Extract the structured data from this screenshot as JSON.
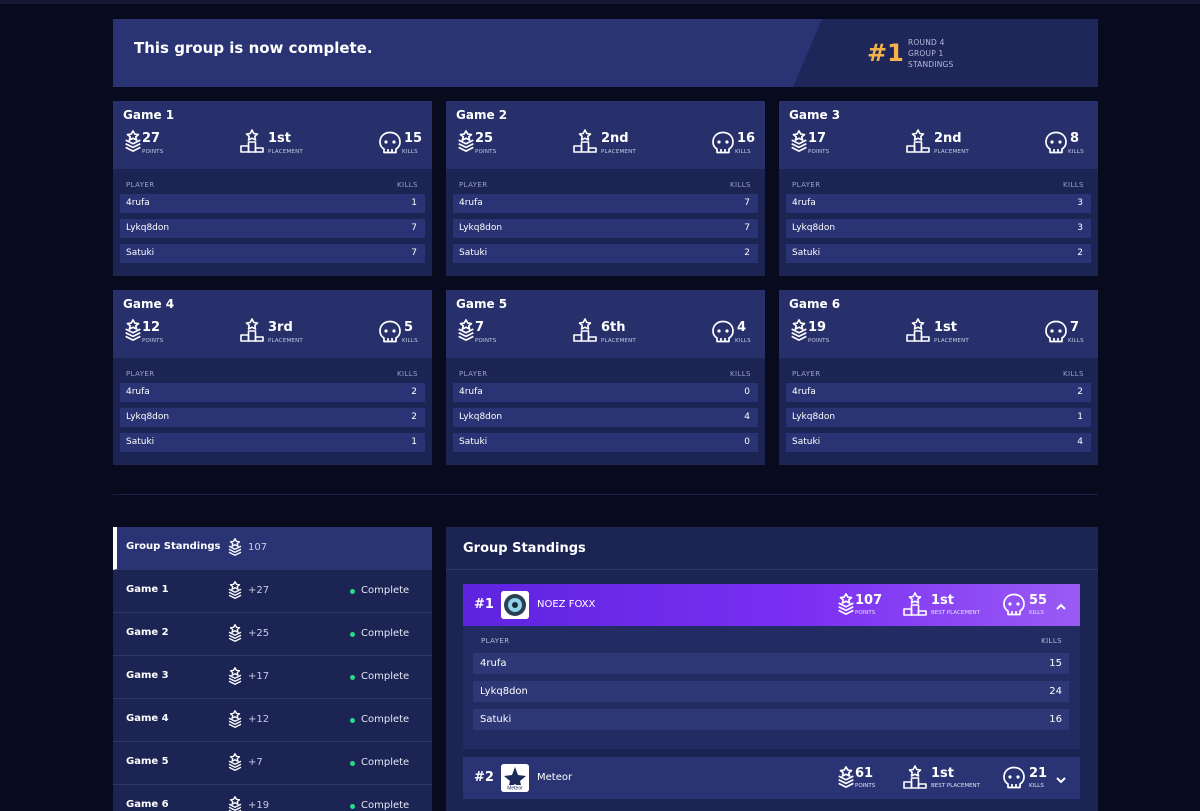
{
  "banner": {
    "message": "This group is now complete.",
    "rank": "#1",
    "meta": [
      "ROUND 4",
      "GROUP 1",
      "STANDINGS"
    ]
  },
  "labels": {
    "points": "POINTS",
    "placement": "PLACEMENT",
    "kills": "KILLS",
    "player": "PLAYER",
    "best_placement": "BEST PLACEMENT",
    "complete": "Complete"
  },
  "games": [
    {
      "title": "Game 1",
      "points": "27",
      "placement": "1st",
      "kills": "15",
      "players": [
        {
          "name": "4rufa",
          "kills": "1"
        },
        {
          "name": "Lykq8don",
          "kills": "7"
        },
        {
          "name": "Satuki",
          "kills": "7"
        }
      ]
    },
    {
      "title": "Game 2",
      "points": "25",
      "placement": "2nd",
      "kills": "16",
      "players": [
        {
          "name": "4rufa",
          "kills": "7"
        },
        {
          "name": "Lykq8don",
          "kills": "7"
        },
        {
          "name": "Satuki",
          "kills": "2"
        }
      ]
    },
    {
      "title": "Game 3",
      "points": "17",
      "placement": "2nd",
      "kills": "8",
      "players": [
        {
          "name": "4rufa",
          "kills": "3"
        },
        {
          "name": "Lykq8don",
          "kills": "3"
        },
        {
          "name": "Satuki",
          "kills": "2"
        }
      ]
    },
    {
      "title": "Game 4",
      "points": "12",
      "placement": "3rd",
      "kills": "5",
      "players": [
        {
          "name": "4rufa",
          "kills": "2"
        },
        {
          "name": "Lykq8don",
          "kills": "2"
        },
        {
          "name": "Satuki",
          "kills": "1"
        }
      ]
    },
    {
      "title": "Game 5",
      "points": "7",
      "placement": "6th",
      "kills": "4",
      "players": [
        {
          "name": "4rufa",
          "kills": "0"
        },
        {
          "name": "Lykq8don",
          "kills": "4"
        },
        {
          "name": "Satuki",
          "kills": "0"
        }
      ]
    },
    {
      "title": "Game 6",
      "points": "19",
      "placement": "1st",
      "kills": "7",
      "players": [
        {
          "name": "4rufa",
          "kills": "2"
        },
        {
          "name": "Lykq8don",
          "kills": "1"
        },
        {
          "name": "Satuki",
          "kills": "4"
        }
      ]
    }
  ],
  "left_panel": {
    "items": [
      {
        "label": "Group Standings",
        "value": "107",
        "status": ""
      },
      {
        "label": "Game 1",
        "value": "+27",
        "status": "Complete"
      },
      {
        "label": "Game 2",
        "value": "+25",
        "status": "Complete"
      },
      {
        "label": "Game 3",
        "value": "+17",
        "status": "Complete"
      },
      {
        "label": "Game 4",
        "value": "+12",
        "status": "Complete"
      },
      {
        "label": "Game 5",
        "value": "+7",
        "status": "Complete"
      },
      {
        "label": "Game 6",
        "value": "+19",
        "status": "Complete"
      }
    ]
  },
  "right_panel": {
    "title": "Group Standings",
    "teams": [
      {
        "rank": "#1",
        "name": "NOEZ FOXX",
        "points": "107",
        "best_placement": "1st",
        "kills": "55",
        "expanded": true,
        "players": [
          {
            "name": "4rufa",
            "kills": "15"
          },
          {
            "name": "Lykq8don",
            "kills": "24"
          },
          {
            "name": "Satuki",
            "kills": "16"
          }
        ]
      },
      {
        "rank": "#2",
        "name": "Meteor",
        "points": "61",
        "best_placement": "1st",
        "kills": "21",
        "expanded": false,
        "players": []
      }
    ]
  },
  "colors": {
    "accent_gold": "#f6b349",
    "header_purple": "#7b2ff2",
    "complete_green": "#2bd98a"
  }
}
